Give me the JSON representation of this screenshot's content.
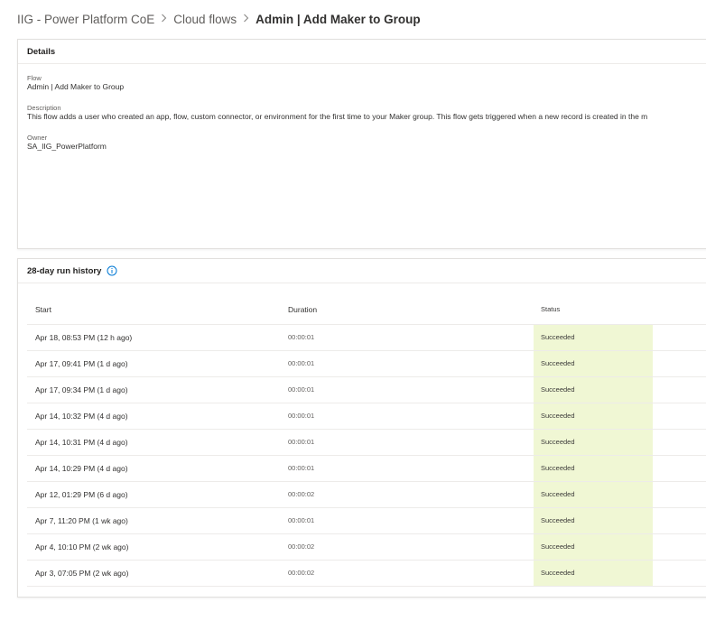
{
  "breadcrumb": {
    "items": [
      "IIG - Power Platform CoE",
      "Cloud flows"
    ],
    "current": "Admin | Add Maker to Group",
    "separator": ">"
  },
  "details": {
    "header": "Details",
    "flow_label": "Flow",
    "flow_value": "Admin | Add Maker to Group",
    "description_label": "Description",
    "description_value": "This flow adds a user who created an app, flow, custom connector, or environment for the first time to your Maker group. This flow gets triggered when a new record is created in the m",
    "owner_label": "Owner",
    "owner_value": "SA_IIG_PowerPlatform"
  },
  "history": {
    "header": "28-day run history",
    "info_icon": "info-icon",
    "columns": [
      "Start",
      "Duration",
      "Status"
    ],
    "rows": [
      {
        "start": "Apr 18, 08:53 PM (12 h ago)",
        "duration": "00:00:01",
        "status": "Succeeded"
      },
      {
        "start": "Apr 17, 09:41 PM (1 d ago)",
        "duration": "00:00:01",
        "status": "Succeeded"
      },
      {
        "start": "Apr 17, 09:34 PM (1 d ago)",
        "duration": "00:00:01",
        "status": "Succeeded"
      },
      {
        "start": "Apr 14, 10:32 PM (4 d ago)",
        "duration": "00:00:01",
        "status": "Succeeded"
      },
      {
        "start": "Apr 14, 10:31 PM (4 d ago)",
        "duration": "00:00:01",
        "status": "Succeeded"
      },
      {
        "start": "Apr 14, 10:29 PM (4 d ago)",
        "duration": "00:00:01",
        "status": "Succeeded"
      },
      {
        "start": "Apr 12, 01:29 PM (6 d ago)",
        "duration": "00:00:02",
        "status": "Succeeded"
      },
      {
        "start": "Apr 7, 11:20 PM (1 wk ago)",
        "duration": "00:00:01",
        "status": "Succeeded"
      },
      {
        "start": "Apr 4, 10:10 PM (2 wk ago)",
        "duration": "00:00:02",
        "status": "Succeeded"
      },
      {
        "start": "Apr 3, 07:05 PM (2 wk ago)",
        "duration": "00:00:02",
        "status": "Succeeded"
      }
    ]
  },
  "colors": {
    "status_success_bg": "#f0f7d4",
    "accent": "#0078d4"
  }
}
